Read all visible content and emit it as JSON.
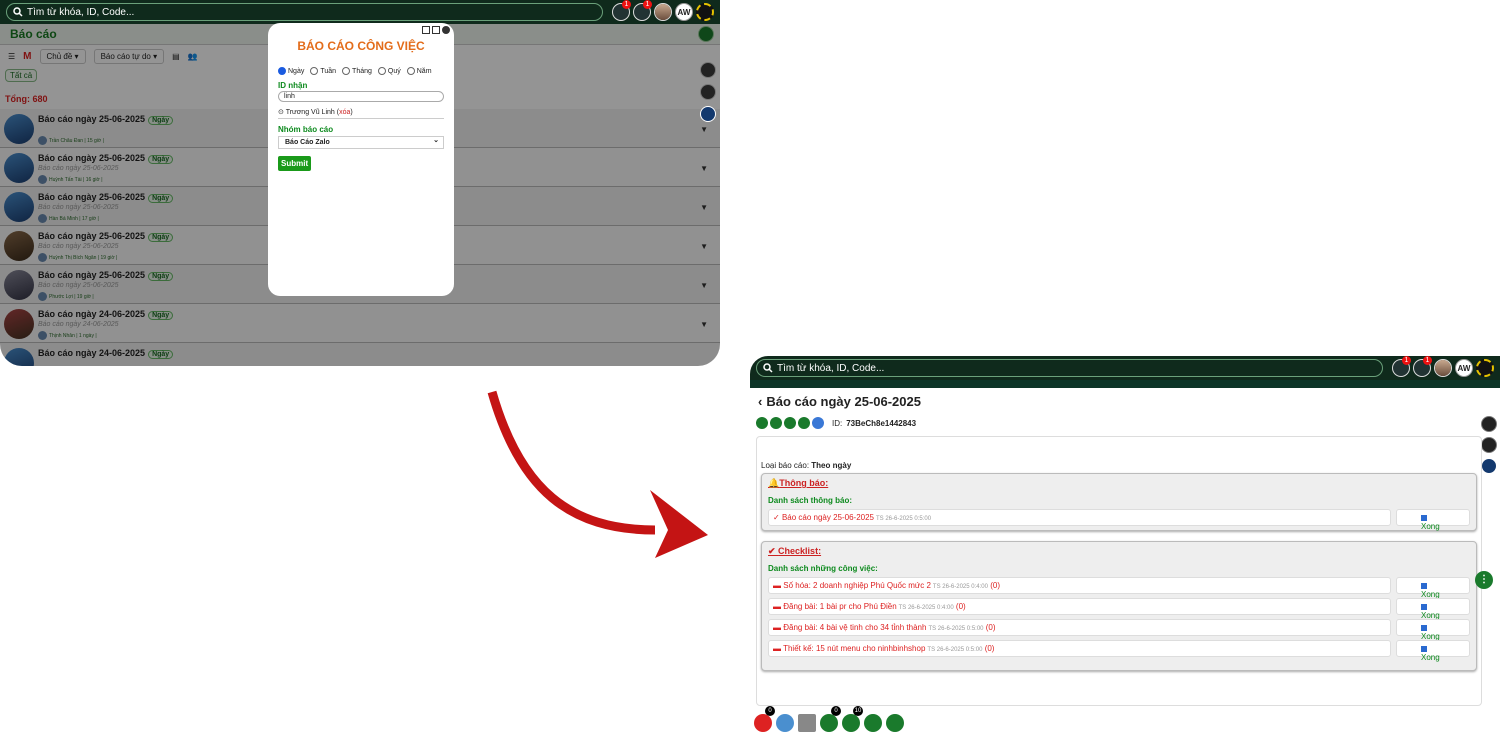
{
  "search_placeholder": "Tìm từ khóa, ID, Code...",
  "notif_badges": [
    "1",
    "1"
  ],
  "left": {
    "page_title": "Báo cáo",
    "filters": {
      "topic": "Chủ đề ▾",
      "report_type": "Báo cáo tự do ▾"
    },
    "all_button": "Tất cả",
    "total": "Tổng: 680",
    "reports": [
      {
        "title": "Báo cáo ngày 25-06-2025",
        "tag": "Ngày",
        "sub": "",
        "by": "Trần Châu Đan | 15 giờ |"
      },
      {
        "title": "Báo cáo ngày 25-06-2025",
        "tag": "Ngày",
        "sub": "Báo cáo ngày 25-06-2025",
        "by": "Huỳnh Tấn Tài | 16 giờ |"
      },
      {
        "title": "Báo cáo ngày 25-06-2025",
        "tag": "Ngày",
        "sub": "Báo cáo ngày 25-06-2025",
        "by": "Hàn Bá Minh | 17 giờ |"
      },
      {
        "title": "Báo cáo ngày 25-06-2025",
        "tag": "Ngày",
        "sub": "Báo cáo ngày 25-06-2025",
        "by": "Huỳnh Thị Bích Ngân | 19 giờ |"
      },
      {
        "title": "Báo cáo ngày 25-06-2025",
        "tag": "Ngày",
        "sub": "Báo cáo ngày 25-06-2025",
        "by": "Phước Lợi | 19 giờ |"
      },
      {
        "title": "Báo cáo ngày 24-06-2025",
        "tag": "Ngày",
        "sub": "Báo cáo ngày 24-06-2025",
        "by": "Thịnh Nhân | 1 ngày |"
      },
      {
        "title": "Báo cáo ngày 24-06-2025",
        "tag": "Ngày",
        "sub": "",
        "by": ""
      }
    ],
    "modal": {
      "title": "BÁO CÁO CÔNG VIỆC",
      "periods": [
        "Ngày",
        "Tuần",
        "Tháng",
        "Quý",
        "Năm"
      ],
      "selected_period": "Ngày",
      "id_label": "ID nhận",
      "id_value": "linh",
      "selected_person": "Trương Vũ Linh (",
      "remove_text": "xóa",
      "remove_close": ")",
      "group_label": "Nhóm báo cáo",
      "group_value": "Báo Cáo Zalo",
      "submit": "Submit"
    }
  },
  "right": {
    "title": "Báo cáo ngày 25-06-2025",
    "id_label": "ID:",
    "id_value": "73BeCh8e1442843",
    "type_label": "Loại báo cáo:",
    "type_value": "Theo ngày",
    "notice": {
      "title": "Thông báo:",
      "list_label": "Danh sách thông báo:",
      "items": [
        {
          "text": "Báo cáo ngày 25-06-2025",
          "time": "TS 26-6-2025 0:5:00",
          "done": "Xong"
        }
      ]
    },
    "checklist": {
      "title": "Checklist:",
      "list_label": "Danh sách những công việc:",
      "items": [
        {
          "text": "Số hóa: 2 doanh nghiệp Phú Quốc mức 2",
          "time": "TS 26-6-2025 0:4:00",
          "count": "(0)",
          "done": "Xong"
        },
        {
          "text": "Đăng bài: 1 bài pr cho Phú Điền",
          "time": "TS 26-6-2025 0:4:00",
          "count": "(0)",
          "done": "Xong"
        },
        {
          "text": "Đăng bài: 4 bài vệ tinh cho 34 tỉnh thành",
          "time": "TS 26-6-2025 0:5:00",
          "count": "(0)",
          "done": "Xong"
        },
        {
          "text": "Thiết kế: 15 nút menu cho ninhbinhshop",
          "time": "TS 26-6-2025 0:5:00",
          "count": "(0)",
          "done": "Xong"
        }
      ]
    },
    "bottom_counts": {
      "likes": "0",
      "add": "0",
      "views": "10"
    }
  }
}
